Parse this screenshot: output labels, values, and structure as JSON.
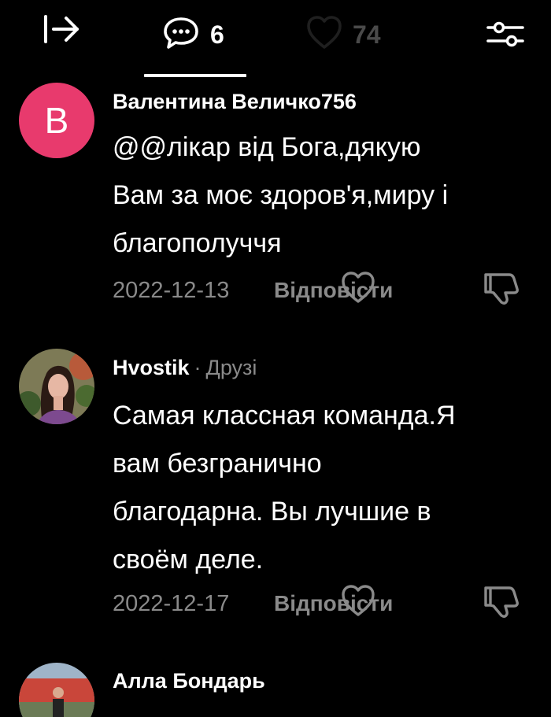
{
  "header": {
    "collapse_icon": "collapse-right-icon",
    "comments_tab": {
      "icon": "chat-bubble-icon",
      "count": "6"
    },
    "likes_tab": {
      "icon": "heart-icon",
      "count": "74"
    },
    "filter_icon": "sliders-icon",
    "accent_color": "#ffffff",
    "inactive_color": "#4a4a4a"
  },
  "comments": [
    {
      "avatar_letter": "В",
      "avatar_color": "#e83a6d",
      "author": "Валентина Величко756",
      "text_lines": [
        "@@лікар від Бога,дякую",
        "Вам за моє здоров'я,миру і",
        "благополуччя"
      ],
      "date": "2022-12-13",
      "reply_label": "Відповісти"
    },
    {
      "author": "Hvostik",
      "separator": "·",
      "tag": "Друзі",
      "text_lines": [
        "Самая классная команда.Я",
        "вам безгранично",
        "благодарна. Вы лучшие в",
        "своём деле."
      ],
      "date": "2022-12-17",
      "reply_label": "Відповісти"
    },
    {
      "author": "Алла Бондарь"
    }
  ]
}
